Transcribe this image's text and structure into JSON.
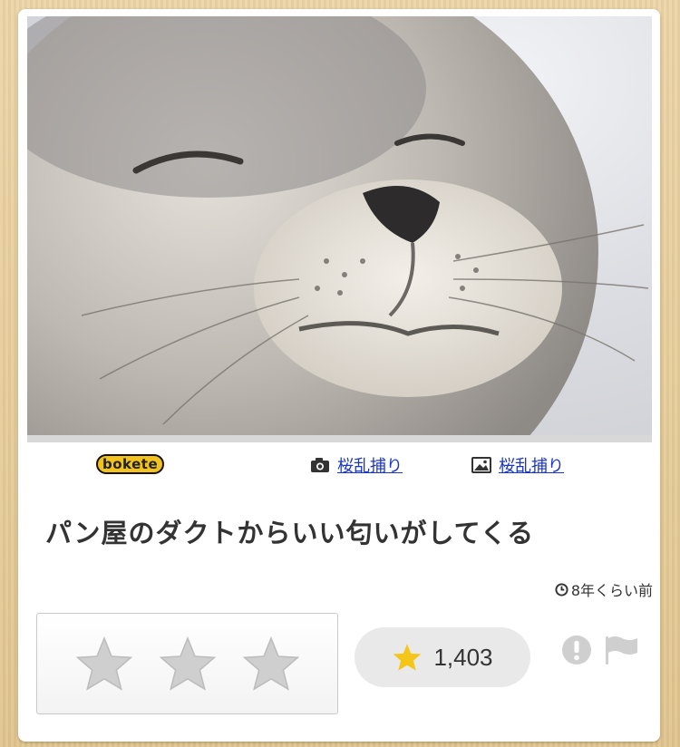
{
  "photo": {
    "subject": "seal-photo",
    "background_color": "#dcdde2"
  },
  "logo": {
    "text": "bokete"
  },
  "credits": [
    {
      "icon": "camera-icon",
      "label": "桜乱捕り"
    },
    {
      "icon": "image-icon",
      "label": "桜乱捕り"
    }
  ],
  "post": {
    "title": "パン屋のダクトからいい匂いがしてくる",
    "time": "8年くらい前"
  },
  "rating": {
    "stars": 3,
    "star_color": "#cfcfcf",
    "count": "1,403",
    "count_star_color": "#f5c518"
  },
  "actions": {
    "report_icon": "exclamation-icon",
    "flag_icon": "flag-icon"
  }
}
